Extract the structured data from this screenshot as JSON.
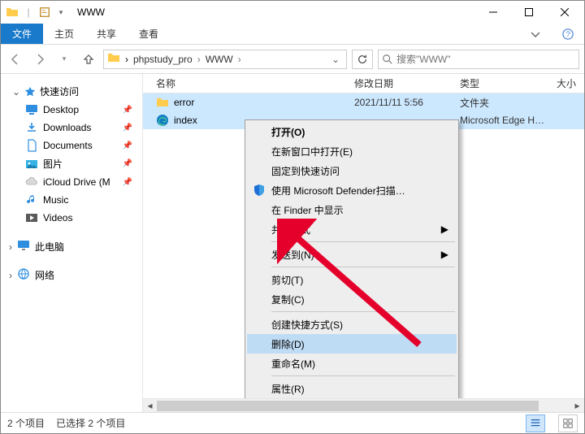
{
  "window": {
    "title": "WWW"
  },
  "ribbon": {
    "file": "文件",
    "home": "主页",
    "share": "共享",
    "view": "查看"
  },
  "address": {
    "crumbs": [
      "phpstudy_pro",
      "WWW"
    ],
    "search_placeholder": "搜索\"WWW\""
  },
  "sidebar": {
    "quick_access": "快速访问",
    "items": [
      {
        "label": "Desktop"
      },
      {
        "label": "Downloads"
      },
      {
        "label": "Documents"
      },
      {
        "label": "图片"
      },
      {
        "label": "iCloud Drive (M"
      },
      {
        "label": "Music"
      },
      {
        "label": "Videos"
      }
    ],
    "this_pc": "此电脑",
    "network": "网络"
  },
  "columns": {
    "name": "名称",
    "date": "修改日期",
    "type": "类型",
    "size": "大小"
  },
  "files": [
    {
      "name": "error",
      "date": "2021/11/11 5:56",
      "type": "文件夹",
      "icon": "folder"
    },
    {
      "name": "index",
      "date": "",
      "type": "Microsoft Edge HT…",
      "icon": "edge"
    }
  ],
  "context_menu": {
    "open": "打开(O)",
    "open_new_window": "在新窗口中打开(E)",
    "pin_quick": "固定到快速访问",
    "defender": "使用 Microsoft Defender扫描…",
    "show_finder": "在 Finder 中显示",
    "share_ways": "共享方式",
    "send_to": "发送到(N)",
    "cut": "剪切(T)",
    "copy": "复制(C)",
    "shortcut": "创建快捷方式(S)",
    "delete": "删除(D)",
    "rename": "重命名(M)",
    "properties": "属性(R)"
  },
  "status": {
    "count": "2 个项目",
    "selected": "已选择 2 个项目"
  }
}
